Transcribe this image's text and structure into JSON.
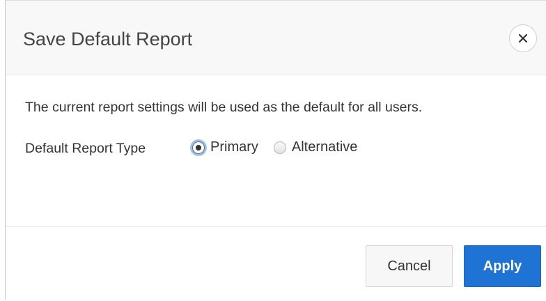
{
  "dialog": {
    "title": "Save Default Report",
    "description": "The current report settings will be used as the default for all users.",
    "report_type": {
      "label": "Default Report Type",
      "options": [
        {
          "label": "Primary",
          "checked": true
        },
        {
          "label": "Alternative",
          "checked": false
        }
      ]
    },
    "buttons": {
      "cancel_label": "Cancel",
      "apply_label": "Apply"
    }
  },
  "colors": {
    "header_bg": "#f8f8f8",
    "primary_button": "#1e73d4",
    "focus_ring": "#9cc3ee"
  },
  "icons": {
    "close": "close-icon"
  }
}
